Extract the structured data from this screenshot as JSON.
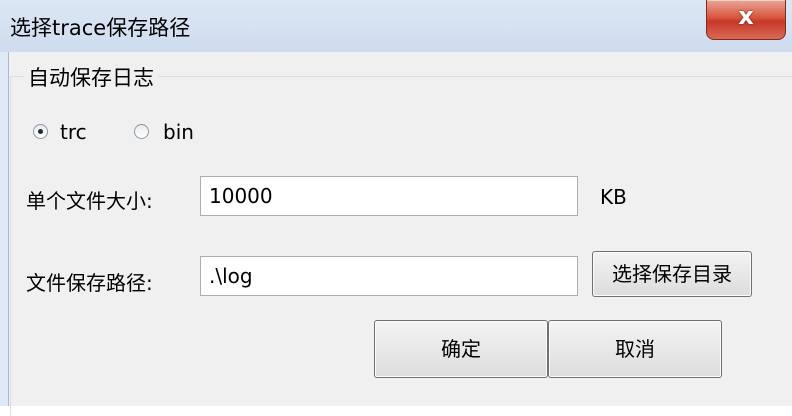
{
  "window": {
    "title": "选择trace保存路径",
    "close_glyph": "x"
  },
  "group": {
    "title": "自动保存日志"
  },
  "format": {
    "options": [
      {
        "label": "trc",
        "checked": true
      },
      {
        "label": "bin",
        "checked": false
      }
    ]
  },
  "file_size": {
    "label": "单个文件大小:",
    "value": "10000",
    "unit": "KB"
  },
  "save_path": {
    "label": "文件保存路径:",
    "value": ".\\log",
    "browse_label": "选择保存目录"
  },
  "actions": {
    "ok_label": "确定",
    "cancel_label": "取消"
  }
}
